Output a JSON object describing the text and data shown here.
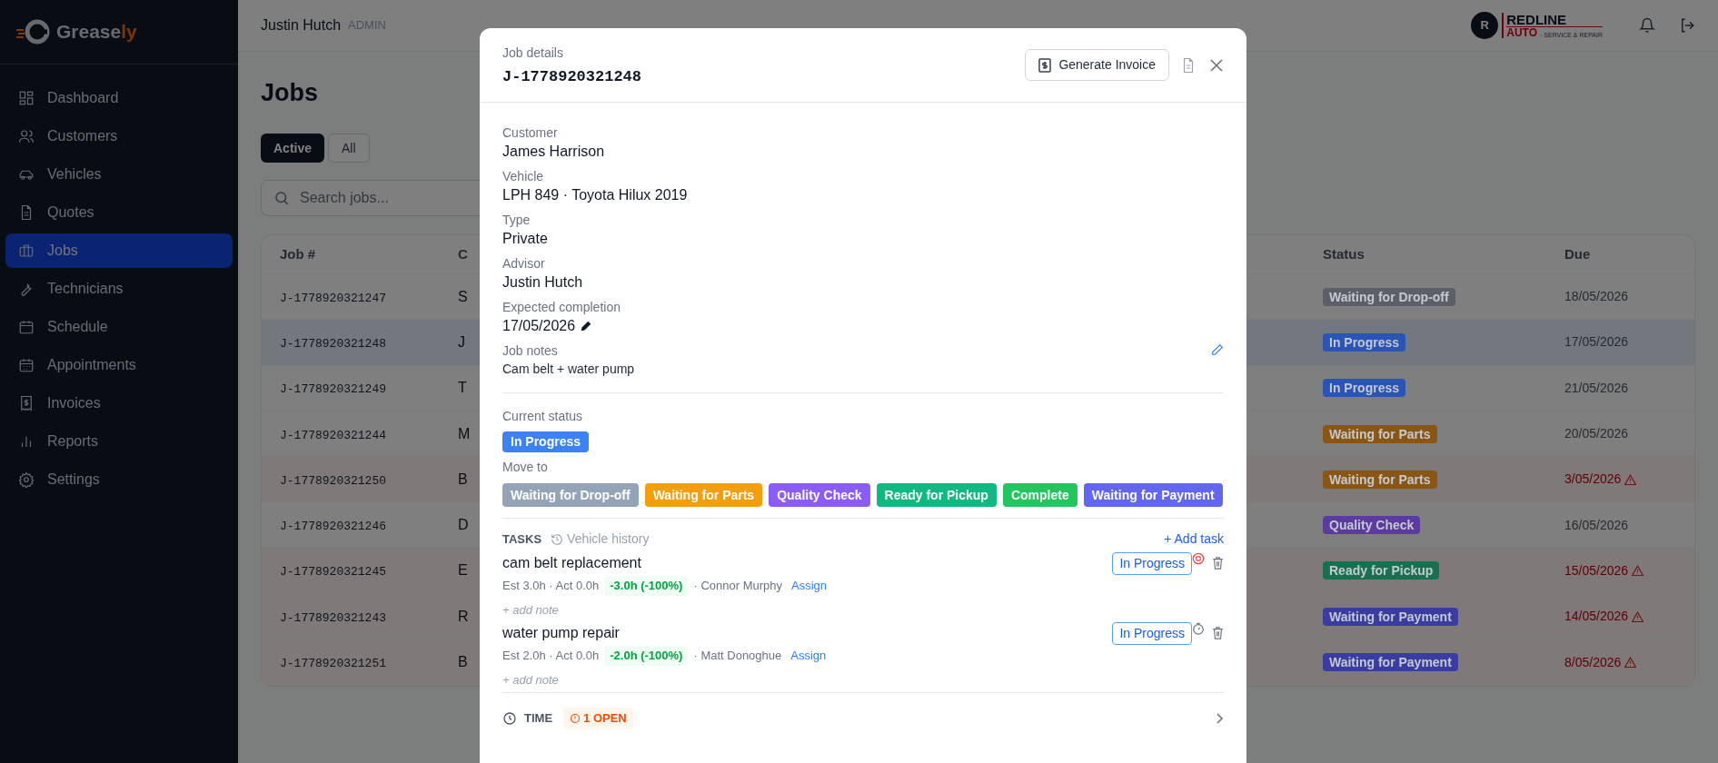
{
  "app": {
    "name_main": "Grease",
    "name_accent": "ly"
  },
  "sidebar": {
    "items": [
      {
        "label": "Dashboard",
        "selected": false
      },
      {
        "label": "Customers",
        "selected": false
      },
      {
        "label": "Vehicles",
        "selected": false
      },
      {
        "label": "Quotes",
        "selected": false
      },
      {
        "label": "Jobs",
        "selected": true
      },
      {
        "label": "Technicians",
        "selected": false
      },
      {
        "label": "Schedule",
        "selected": false
      },
      {
        "label": "Appointments",
        "selected": false
      },
      {
        "label": "Invoices",
        "selected": false
      },
      {
        "label": "Reports",
        "selected": false
      },
      {
        "label": "Settings",
        "selected": false
      }
    ]
  },
  "header": {
    "user": "Justin Hutch",
    "role": "ADMIN",
    "brand": {
      "badge": "R",
      "name": "REDLINE",
      "sub": "AUTO",
      "tagline": "· SERVICE & REPAIR"
    }
  },
  "page": {
    "title": "Jobs",
    "filters": [
      {
        "label": "Active",
        "selected": true
      },
      {
        "label": "All",
        "selected": false
      }
    ],
    "search": {
      "placeholder": "Search jobs..."
    }
  },
  "table": {
    "columns": [
      "Job #",
      "C",
      "Status",
      "Due"
    ],
    "rows": [
      {
        "job": "J-1778920321247",
        "column_2": "S",
        "status": "Waiting for Drop-off",
        "color": "#5b6068",
        "due": "18/05/2026",
        "overdue": false,
        "selected": false
      },
      {
        "job": "J-1778920321248",
        "column_2": "J",
        "status": "In Progress",
        "color": "#2a55b5",
        "due": "17/05/2026",
        "overdue": false,
        "selected": true
      },
      {
        "job": "J-1778920321249",
        "column_2": "T",
        "status": "In Progress",
        "color": "#2a55b5",
        "due": "21/05/2026",
        "overdue": false,
        "selected": false
      },
      {
        "job": "J-1778920321244",
        "column_2": "M",
        "status": "Waiting for Parts",
        "color": "#8a5614",
        "due": "20/05/2026",
        "overdue": false,
        "selected": false
      },
      {
        "job": "J-1778920321250",
        "column_2": "B",
        "status": "Waiting for Parts",
        "color": "#8a5614",
        "due": "3/05/2026",
        "overdue": true,
        "selected": false
      },
      {
        "job": "J-1778920321246",
        "column_2": "D",
        "status": "Quality Check",
        "color": "#5b3b9e",
        "due": "16/05/2026",
        "overdue": false,
        "selected": false
      },
      {
        "job": "J-1778920321245",
        "column_2": "E",
        "status": "Ready for Pickup",
        "color": "#17704f",
        "due": "15/05/2026",
        "overdue": true,
        "selected": false
      },
      {
        "job": "J-1778920321243",
        "column_2": "R",
        "status": "Waiting for Payment",
        "color": "#3b3ca0",
        "due": "14/05/2026",
        "overdue": true,
        "selected": false
      },
      {
        "job": "J-1778920321251",
        "column_2": "B",
        "status": "Waiting for Payment",
        "color": "#3b3ca0",
        "due": "8/05/2026",
        "overdue": true,
        "selected": false
      }
    ]
  },
  "modal": {
    "title": "Job details",
    "job_number": "J-1778920321248",
    "invoice_button": "Generate Invoice",
    "fields": [
      {
        "label": "Customer",
        "value": "James Harrison"
      },
      {
        "label": "Vehicle",
        "value": "LPH 849 · Toyota Hilux 2019"
      },
      {
        "label": "Type",
        "value": "Private"
      },
      {
        "label": "Advisor",
        "value": "Justin Hutch"
      },
      {
        "label": "Expected completion",
        "value": "17/05/2026"
      }
    ],
    "notes": {
      "label": "Job notes",
      "value": "Cam belt + water pump"
    },
    "current_status": {
      "label": "Current status",
      "value": "In Progress",
      "color": "#3b82f6"
    },
    "move_to": {
      "label": "Move to",
      "options": [
        {
          "label": "Waiting for Drop-off",
          "color": "#94a3b8"
        },
        {
          "label": "Waiting for Parts",
          "color": "#f59e0b"
        },
        {
          "label": "Quality Check",
          "color": "#8b5cf6"
        },
        {
          "label": "Ready for Pickup",
          "color": "#10b981"
        },
        {
          "label": "Complete",
          "color": "#22c55e"
        },
        {
          "label": "Waiting for Payment",
          "color": "#6366f1"
        }
      ]
    },
    "tasks": {
      "heading": "TASKS",
      "history_link": "Vehicle history",
      "add_button": "+ Add task",
      "items": [
        {
          "title": "cam belt replacement",
          "estimate": "Est 3.0h · Act 0.0h",
          "variance": "-3.0h (-100%)",
          "technician": "· Connor Murphy",
          "assign": "Assign",
          "note_link": "+ add note",
          "status": "In Progress",
          "timer_running": true
        },
        {
          "title": "water pump repair",
          "estimate": "Est 2.0h · Act 0.0h",
          "variance": "-2.0h (-100%)",
          "technician": "· Matt Donoghue",
          "assign": "Assign",
          "note_link": "+ add note",
          "status": "In Progress",
          "timer_running": false
        }
      ]
    },
    "time": {
      "heading": "TIME",
      "open_badge": "1 OPEN"
    }
  }
}
